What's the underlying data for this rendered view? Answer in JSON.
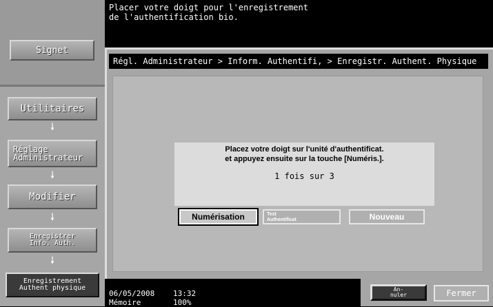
{
  "header": {
    "instruction_line1": "Placer votre doigt pour l'enregistrement",
    "instruction_line2": "de l'authentification bio."
  },
  "sidebar": {
    "bookmark_label": "Signet",
    "steps": [
      {
        "label": "Utilitaires"
      },
      {
        "label_line1": "Réglage",
        "label_line2": "Administrateur"
      },
      {
        "label": "Modifier"
      },
      {
        "label_line1": "Enregistrer",
        "label_line2": "Info. Auth."
      },
      {
        "label_line1": "Enregistrement",
        "label_line2": "Authent physique"
      }
    ],
    "arrow_glyph": "🠗"
  },
  "breadcrumb": "Régl. Administrateur > Inform. Authentifi, > Enregistr. Authent. Physique",
  "dialog": {
    "message_line1": "Placez votre doigt sur l'unité d'authentificat.",
    "message_line2": "et appuyez ensuite sur la touche [Numéris.].",
    "count_text": "1 fois sur 3",
    "scan_button": "Numérisation",
    "test_button_line1": "Test",
    "test_button_line2": "Authentificat",
    "new_button": "Nouveau"
  },
  "status": {
    "date": "06/05/2008",
    "time": "13:32",
    "memory_label": "Mémoire",
    "memory_value": "100%"
  },
  "footer": {
    "cancel_line1": "An-",
    "cancel_line2": "nuler",
    "close_button": "Fermer"
  },
  "colors": {
    "panel_gray": "#a6a6a6",
    "content_gray": "#b8b8b8",
    "dialog_gray": "#dcdcdc",
    "black": "#000000"
  }
}
